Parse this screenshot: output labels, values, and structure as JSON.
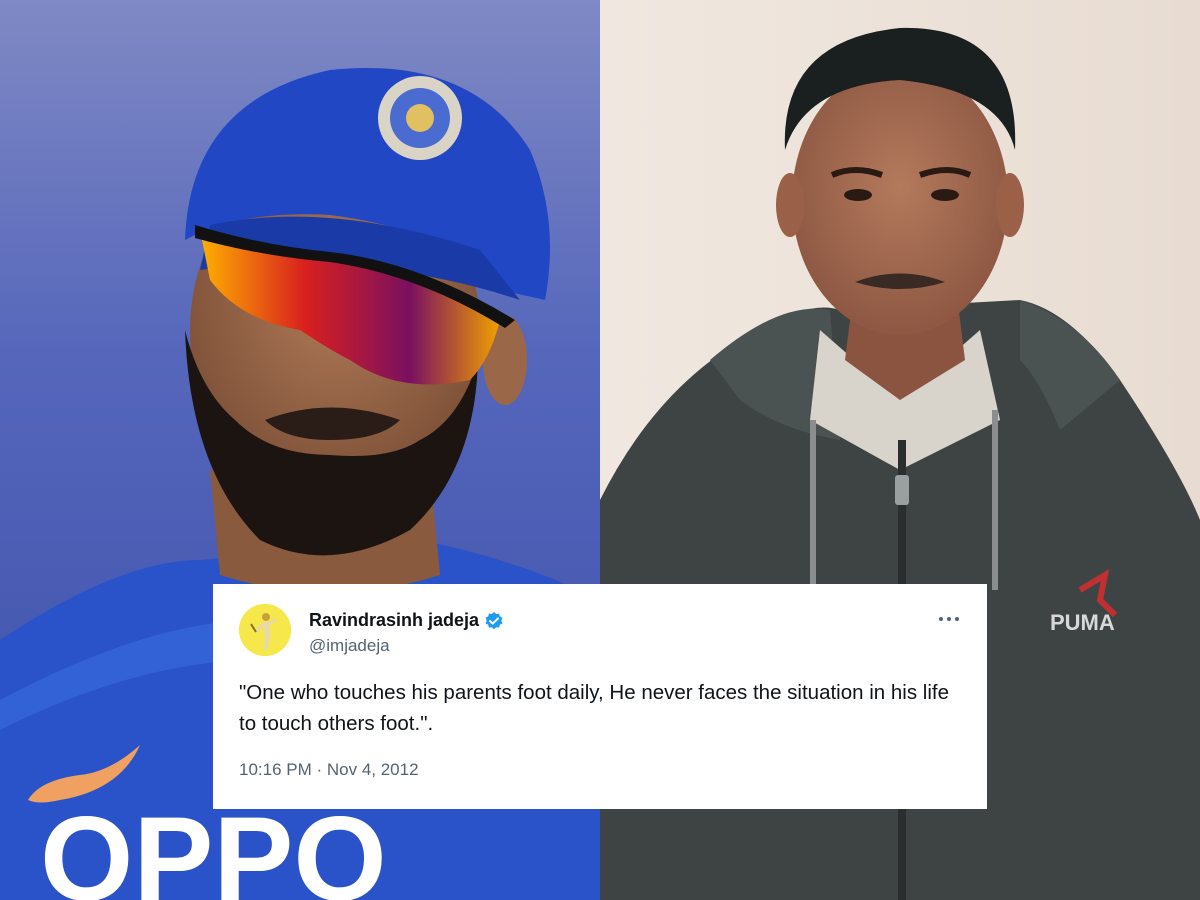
{
  "photos": {
    "left": {
      "shirt_logo_text": "OPPO"
    },
    "right": {
      "jacket_logo_text": "PUMA"
    }
  },
  "tweet": {
    "display_name": "Ravindrasinh jadeja",
    "handle": "@imjadeja",
    "text": "\"One who touches his parents foot daily, He never faces the situation in his life to touch others foot.\".",
    "timestamp": "10:16 PM · Nov 4, 2012",
    "avatar_icon": "cricketer-avatar-icon",
    "verified_icon": "verified-badge-icon",
    "more_icon": "more-options-icon",
    "accent_color": "#1d9bf0"
  },
  "colors": {
    "left_background": "#5d6fb8",
    "jersey_blue": "#2a53c9",
    "right_background": "#ece3db",
    "jacket": "#3e4444",
    "avatar_background": "#f6e84a"
  }
}
